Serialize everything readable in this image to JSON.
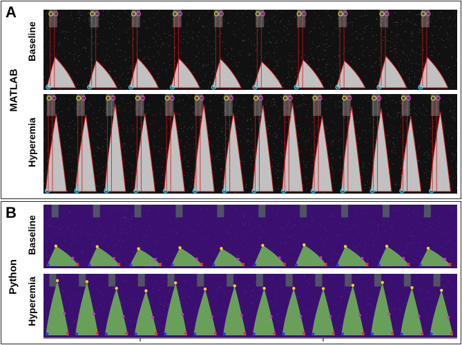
{
  "panel_a": {
    "letter": "A",
    "method_label": "MATLAB",
    "rows": [
      {
        "label": "Baseline",
        "beats": 10,
        "peak": 0.38,
        "style": "matlab"
      },
      {
        "label": "Hyperemia",
        "beats": 14,
        "peak": 0.85,
        "style": "matlab"
      }
    ]
  },
  "panel_b": {
    "letter": "B",
    "method_label": "Python",
    "rows": [
      {
        "label": "Baseline",
        "beats": 10,
        "peak": 0.32,
        "style": "python"
      },
      {
        "label": "Hyperemia",
        "beats": 14,
        "peak": 0.82,
        "style": "python"
      }
    ]
  },
  "colors": {
    "matlab_bg": "#111111",
    "matlab_signal": "#e8e8e8",
    "matlab_trace": "#d0141a",
    "python_bg": "#3b0f70",
    "python_signal": "#7ad151",
    "python_peak": "#ffd21f",
    "python_min": "#ff2a2a",
    "python_valley": "#1f3cff",
    "python_mid": "#cc2fd0",
    "marker_yellow": "#ffe000",
    "marker_magenta": "#ff2bd6",
    "marker_cyan": "#22e6ff"
  }
}
